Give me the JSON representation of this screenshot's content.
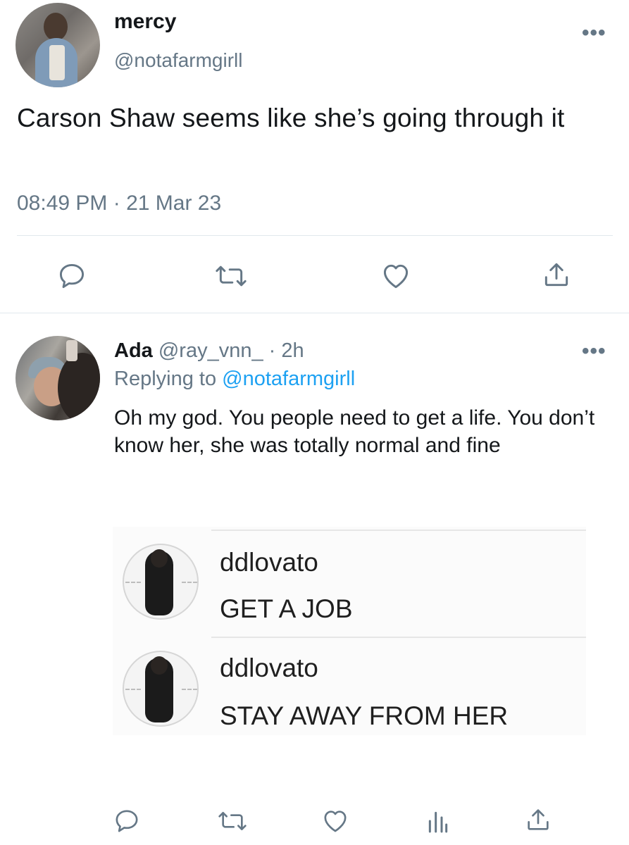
{
  "tweet": {
    "display_name": "mercy",
    "handle": "@notafarmgirll",
    "text": "Carson Shaw seems like she’s going through it",
    "time": "08:49 PM · 21 Mar 23",
    "more_label": "•••"
  },
  "reply": {
    "display_name": "Ada",
    "handle_time": "@ray_vnn_ · 2h",
    "replying_prefix": "Replying to",
    "replying_to": "@notafarmgirll",
    "text": "Oh my god. You people need to get a life. You don’t know her, she was totally normal and fine",
    "more_label": "•••"
  },
  "embedded_image": {
    "comments": [
      {
        "username": "ddlovato",
        "message": "GET A JOB"
      },
      {
        "username": "ddlovato",
        "message": "STAY AWAY FROM HER"
      }
    ]
  },
  "icons": {
    "main_actions": [
      "reply-icon",
      "retweet-icon",
      "like-icon",
      "share-icon"
    ],
    "reply_actions": [
      "reply-icon",
      "retweet-icon",
      "like-icon",
      "analytics-icon",
      "share-icon"
    ]
  },
  "colors": {
    "text": "#14171a",
    "secondary": "#657786",
    "link": "#1da1f2",
    "divider": "#e1e8ed"
  }
}
